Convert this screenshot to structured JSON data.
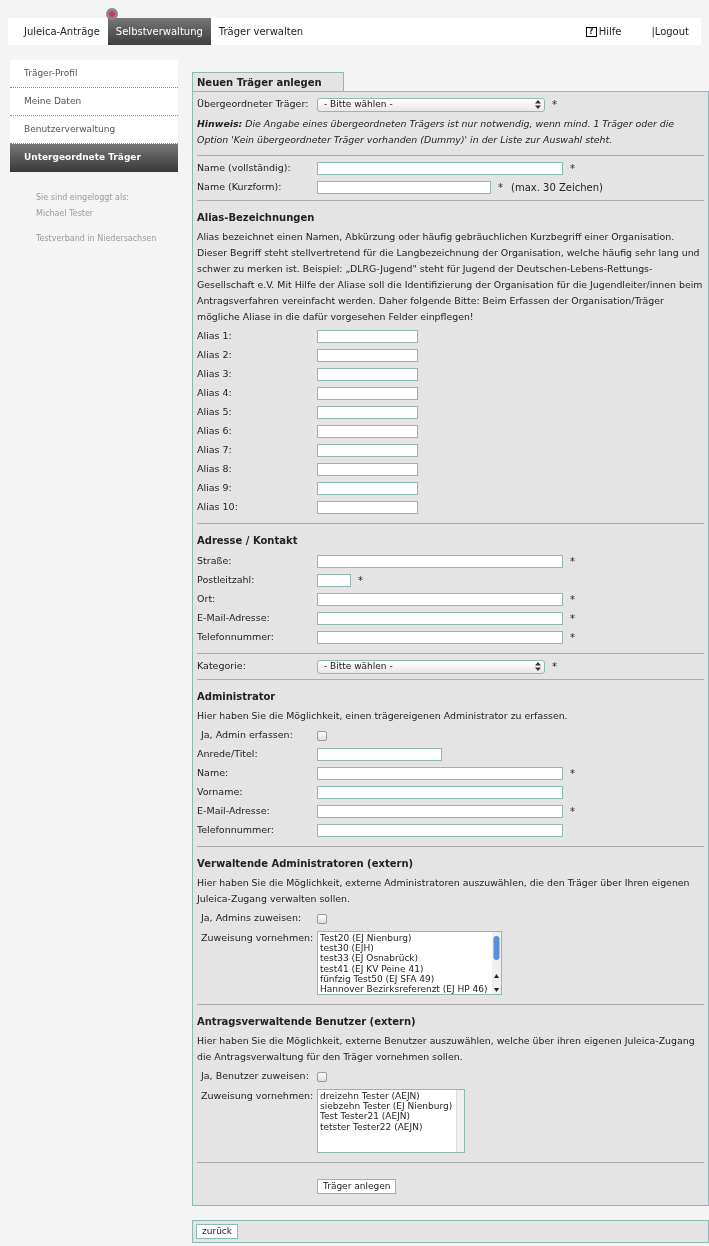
{
  "nav": {
    "tabs": [
      {
        "label": "Juleica-Anträge",
        "selected": false
      },
      {
        "label": "Selbstverwaltung",
        "selected": true
      },
      {
        "label": "Träger verwalten",
        "selected": false
      }
    ],
    "help_icon": "?",
    "help": "Hilfe",
    "logout": "|Logout"
  },
  "sidebar": {
    "items": [
      {
        "label": "Träger-Profil",
        "selected": false
      },
      {
        "label": "Meine Daten",
        "selected": false
      },
      {
        "label": "Benutzerverwaltung",
        "selected": false
      },
      {
        "label": "Untergeordnete Träger",
        "selected": true
      }
    ],
    "login_label": "Sie sind eingeloggt als:",
    "user": "Michael Tester",
    "org": "Testverband in Niedersachsen"
  },
  "form": {
    "tab": "Neuen Träger anlegen",
    "sections": [
      {
        "rows": [
          {
            "kind": "select",
            "label": "Übergeordneter Träger:",
            "value": "- Bitte wählen -",
            "suffix": "*"
          }
        ],
        "hint": "**Hinweis:** Die Angabe eines übergeordneten Trägers ist nur notwendig, wenn mind. 1 Träger oder die Option 'Kein übergeordneter Träger vorhanden (Dummy)' in der Liste zur Auswahl steht."
      },
      {
        "rows": [
          {
            "kind": "long",
            "label": "Name (vollständig):",
            "suffix": "*"
          },
          {
            "kind": "medium",
            "label": "Name (Kurzform):",
            "suffix": "*",
            "note": "(max. 30 Zeichen)"
          }
        ]
      },
      {
        "heading": "Alias-Bezeichnungen",
        "text": "Alias bezeichnet einen Namen, Abkürzung oder häufig gebräuchlichen Kurzbegriff einer Organisation. Dieser Begriff steht stellvertretend für die Langbezeichnung der Organisation, welche häufig sehr lang und schwer zu merken ist. Beispiel: „DLRG-Jugend\" steht für Jugend der Deutschen-Lebens-Rettungs-Gesellschaft e.V. Mit Hilfe der Aliase soll die Identifizierung der Organisation für die Jugendleiter/innen beim Antragsverfahren vereinfacht werden. Daher folgende Bitte: Beim Erfassen der Organisation/Träger mögliche Aliase in die dafür vorgesehen Felder einpflegen!",
        "rows": [
          {
            "kind": "small",
            "label": "Alias 1:"
          },
          {
            "kind": "small",
            "label": "Alias 2:"
          },
          {
            "kind": "small",
            "label": "Alias 3:"
          },
          {
            "kind": "small",
            "label": "Alias 4:"
          },
          {
            "kind": "small",
            "label": "Alias 5:"
          },
          {
            "kind": "small",
            "label": "Alias 6:"
          },
          {
            "kind": "small",
            "label": "Alias 7:"
          },
          {
            "kind": "small",
            "label": "Alias 8:"
          },
          {
            "kind": "small",
            "label": "Alias 9:"
          },
          {
            "kind": "small",
            "label": "Alias 10:"
          }
        ]
      },
      {
        "heading": "Adresse / Kontakt",
        "rows": [
          {
            "kind": "long",
            "label": "Straße:",
            "suffix": "*"
          },
          {
            "kind": "tiny",
            "label": "Postleitzahl:",
            "suffix": "*"
          },
          {
            "kind": "long",
            "label": "Ort:",
            "suffix": "*"
          },
          {
            "kind": "long",
            "label": "E-Mail-Adresse:",
            "suffix": "*"
          },
          {
            "kind": "long",
            "label": "Telefonnummer:",
            "suffix": "*"
          }
        ]
      },
      {
        "rows": [
          {
            "kind": "select",
            "label": "Kategorie:",
            "value": "- Bitte wählen -",
            "suffix": "*"
          }
        ]
      },
      {
        "heading": "Administrator",
        "text": "Hier haben Sie die Möglichkeit, einen trägereigenen Administrator zu erfassen.",
        "rows": [
          {
            "kind": "checkbox",
            "label": "Ja, Admin erfassen:",
            "checked": false
          },
          {
            "kind": "short",
            "label": "Anrede/Titel:"
          },
          {
            "kind": "long",
            "label": "Name:",
            "suffix": "*"
          },
          {
            "kind": "long",
            "label": "Vorname:"
          },
          {
            "kind": "long",
            "label": "E-Mail-Adresse:",
            "suffix": "*"
          },
          {
            "kind": "long",
            "label": "Telefonnummer:"
          }
        ]
      },
      {
        "heading": "Verwaltende Administratoren (extern)",
        "text": "Hier haben Sie die Möglichkeit, externe Administratoren auszuwählen, die den Träger über Ihren eigenen Juleica-Zugang verwalten sollen.",
        "rows": [
          {
            "kind": "checkbox",
            "label": "Ja, Admins zuweisen:",
            "checked": false
          },
          {
            "kind": "listbox",
            "label": "Zuweisung vornehmen:",
            "items": [
              "Test20 (EJ Nienburg)",
              "test30 (EJH)",
              "test33 (EJ Osnabrück)",
              "test41 (EJ KV Peine 41)",
              "fünfzig Test50 (EJ SFA 49)",
              "Hannover Bezirksreferenzt (EJ HP 46)"
            ]
          }
        ]
      },
      {
        "heading": "Antragsverwaltende Benutzer (extern)",
        "text": "Hier haben Sie die Möglichkeit, externe Benutzer auszuwählen, welche über ihren eigenen Juleica-Zugang die Antragsverwaltung für den Träger vornehmen sollen.",
        "rows": [
          {
            "kind": "checkbox",
            "label": "Ja, Benutzer zuweisen:",
            "checked": false
          },
          {
            "kind": "listbox",
            "label": "Zuweisung vornehmen:",
            "items": [
              "dreizehn Tester (AEJN)",
              "siebzehn Tester (EJ Nienburg)",
              "Test Tester21 (AEJN)",
              "tetster Tester22 (AEJN)"
            ]
          }
        ]
      }
    ],
    "submit": "Träger anlegen",
    "back": "zurück"
  }
}
